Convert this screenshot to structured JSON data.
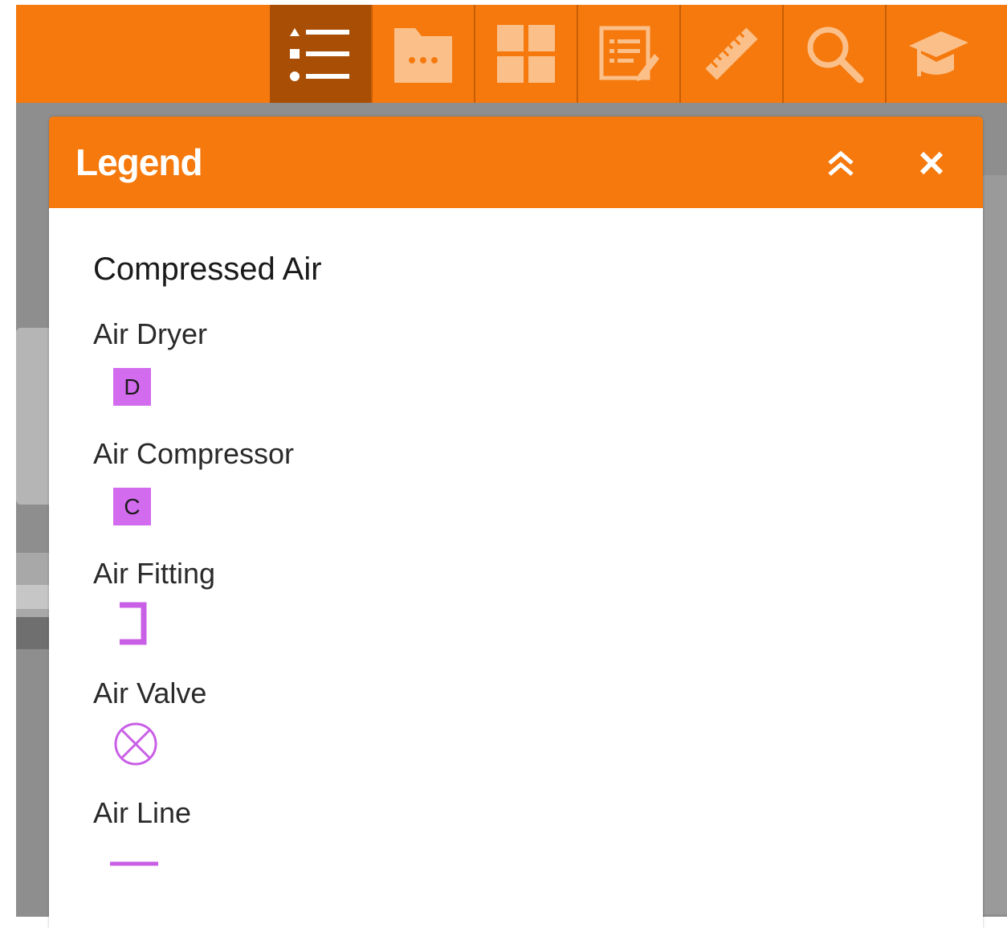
{
  "toolbar": {
    "tools": [
      {
        "icon": "legend-list-icon",
        "active": true
      },
      {
        "icon": "layers-folder-icon",
        "active": false
      },
      {
        "icon": "basemap-grid-icon",
        "active": false
      },
      {
        "icon": "attribute-table-edit-icon",
        "active": false
      },
      {
        "icon": "measure-ruler-icon",
        "active": false
      },
      {
        "icon": "search-icon",
        "active": false
      },
      {
        "icon": "graduation-cap-icon",
        "active": false
      }
    ],
    "color": "#f5790d",
    "active_color": "#a94e05"
  },
  "panel": {
    "title": "Legend",
    "collapse_icon": "chevron-double-up-icon",
    "close_icon": "close-icon"
  },
  "legend": {
    "layer_title": "Compressed Air",
    "symbol_color": "#d36bef",
    "items": [
      {
        "label": "Air Dryer",
        "symbol": "letter-box",
        "letter": "D"
      },
      {
        "label": "Air Compressor",
        "symbol": "letter-box",
        "letter": "C"
      },
      {
        "label": "Air Fitting",
        "symbol": "bracket-icon"
      },
      {
        "label": "Air Valve",
        "symbol": "circle-x-icon"
      },
      {
        "label": "Air Line",
        "symbol": "line-icon"
      }
    ]
  }
}
